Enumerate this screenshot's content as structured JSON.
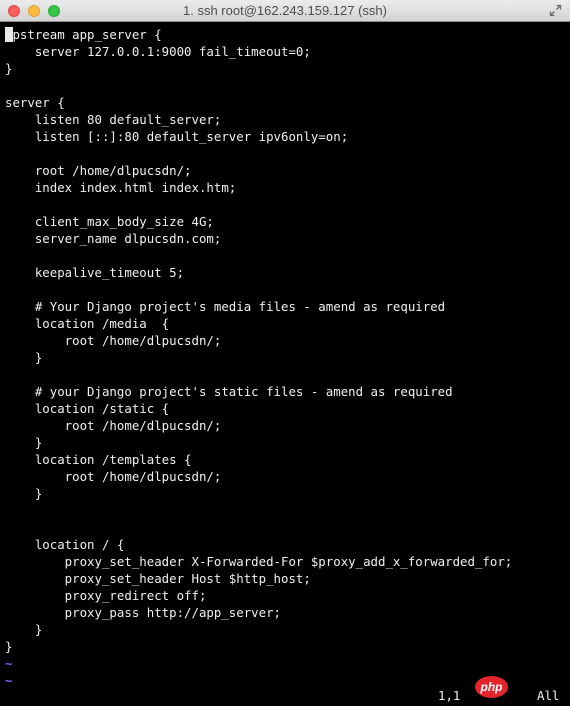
{
  "window": {
    "title": "1. ssh root@162.243.159.127 (ssh)"
  },
  "editor": {
    "lines": [
      "upstream app_server {",
      "    server 127.0.0.1:9000 fail_timeout=0;",
      "}",
      "",
      "server {",
      "    listen 80 default_server;",
      "    listen [::]:80 default_server ipv6only=on;",
      "",
      "    root /home/dlpucsdn/;",
      "    index index.html index.htm;",
      "",
      "    client_max_body_size 4G;",
      "    server_name dlpucsdn.com;",
      "",
      "    keepalive_timeout 5;",
      "",
      "    # Your Django project's media files - amend as required",
      "    location /media  {",
      "        root /home/dlpucsdn/;",
      "    }",
      "",
      "    # your Django project's static files - amend as required",
      "    location /static {",
      "        root /home/dlpucsdn/;",
      "    }",
      "    location /templates {",
      "        root /home/dlpucsdn/;",
      "    }",
      "",
      "",
      "    location / {",
      "        proxy_set_header X-Forwarded-For $proxy_add_x_forwarded_for;",
      "        proxy_set_header Host $http_host;",
      "        proxy_redirect off;",
      "        proxy_pass http://app_server;",
      "    }",
      "}"
    ],
    "empty_markers": [
      "~",
      "~"
    ]
  },
  "statusline": {
    "position": "1,1",
    "scroll": "All"
  },
  "watermark": {
    "text": "php"
  },
  "icons": {
    "close": "close-icon",
    "minimize": "minimize-icon",
    "zoom": "zoom-icon",
    "fullscreen": "fullscreen-icon"
  },
  "colors": {
    "background": "#000000",
    "text": "#f0f0f0",
    "tilde": "#6a6aff",
    "watermark": "#e4252c"
  }
}
